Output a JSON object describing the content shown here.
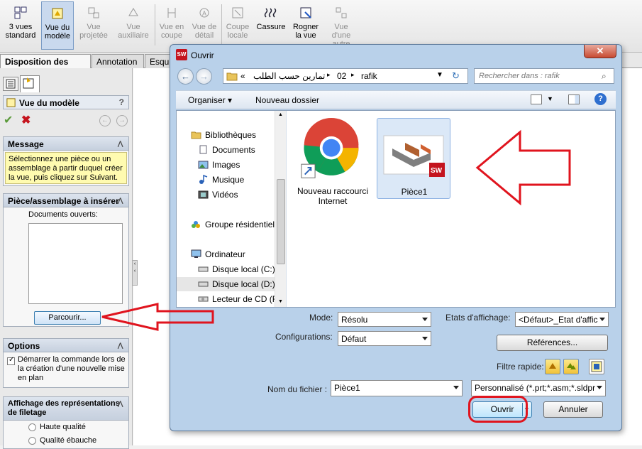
{
  "toolbar": {
    "buttons": [
      {
        "label": "3 vues\nstandard",
        "icon": "standard-views-icon"
      },
      {
        "label": "Vue du\nmodèle",
        "icon": "model-view-icon"
      },
      {
        "label": "Vue\nprojetée",
        "icon": "projected-view-icon"
      },
      {
        "label": "Vue\nauxiliaire",
        "icon": "auxiliary-view-icon"
      },
      {
        "label": "Vue en\ncoupe",
        "icon": "section-view-icon"
      },
      {
        "label": "Vue de\ndétail",
        "icon": "detail-view-icon"
      },
      {
        "label": "Coupe\nlocale",
        "icon": "broken-out-section-icon"
      },
      {
        "label": "Cassure",
        "icon": "break-icon"
      },
      {
        "label": "Rogner\nla vue",
        "icon": "crop-view-icon"
      },
      {
        "label": "Vue\nd'une\nautre",
        "icon": "alternate-position-icon"
      }
    ]
  },
  "tabs": [
    "Disposition des vues",
    "Annotation",
    "Esqui"
  ],
  "panel": {
    "title": "Vue du modèle",
    "help": "?",
    "message_header": "Message",
    "message_text": "Sélectionnez une pièce ou un assemblage à partir duquel créer la vue, puis cliquez sur Suivant.",
    "part_header": "Pièce/assemblage à insérer",
    "open_docs_label": "Documents ouverts:",
    "browse_button": "Parcourir...",
    "options_header": "Options",
    "options_check": "Démarrer la commande lors de la création d'une nouvelle mise en plan",
    "thread_header": "Affichage des représentations de filetage",
    "thread_opt1": "Haute qualité",
    "thread_opt2": "Qualité ébauche"
  },
  "dialog": {
    "title": "Ouvrir",
    "close": "✕",
    "breadcrumb": [
      "«",
      "تمارين حسب الطلب",
      "02",
      "rafik"
    ],
    "search_placeholder": "Rechercher dans : rafik",
    "organize": "Organiser",
    "new_folder": "Nouveau dossier",
    "nav": [
      {
        "label": "Bibliothèques",
        "icon": "libraries-icon"
      },
      {
        "label": "Documents",
        "icon": "documents-icon"
      },
      {
        "label": "Images",
        "icon": "images-icon"
      },
      {
        "label": "Musique",
        "icon": "music-icon"
      },
      {
        "label": "Vidéos",
        "icon": "videos-icon"
      },
      {
        "label": "Groupe résidentiel",
        "icon": "homegroup-icon"
      },
      {
        "label": "Ordinateur",
        "icon": "computer-icon"
      },
      {
        "label": "Disque local (C:)",
        "icon": "drive-icon"
      },
      {
        "label": "Disque local (D:)",
        "icon": "drive-icon"
      },
      {
        "label": "Lecteur de CD (F:",
        "icon": "cd-drive-icon"
      }
    ],
    "files": [
      {
        "name": "Nouveau raccourci Internet",
        "icon": "chrome-shortcut-icon"
      },
      {
        "name": "Pièce1",
        "icon": "solidworks-part-icon"
      }
    ],
    "mode_label": "Mode:",
    "mode_value": "Résolu",
    "config_label": "Configurations:",
    "config_value": "Défaut",
    "display_states_label": "Etats d'affichage:",
    "display_states_value": "<Défaut>_Etat d'affic",
    "references_button": "Références...",
    "quick_filter_label": "Filtre rapide:",
    "filename_label": "Nom du fichier :",
    "filename_value": "Pièce1",
    "filetype_value": "Personnalisé (*.prt;*.asm;*.sldpr",
    "open_button": "Ouvrir",
    "cancel_button": "Annuler"
  },
  "colors": {
    "annotation_red": "#e0141e",
    "dialog_frame": "#b9d1ea",
    "message_bg": "#fffbb0"
  }
}
